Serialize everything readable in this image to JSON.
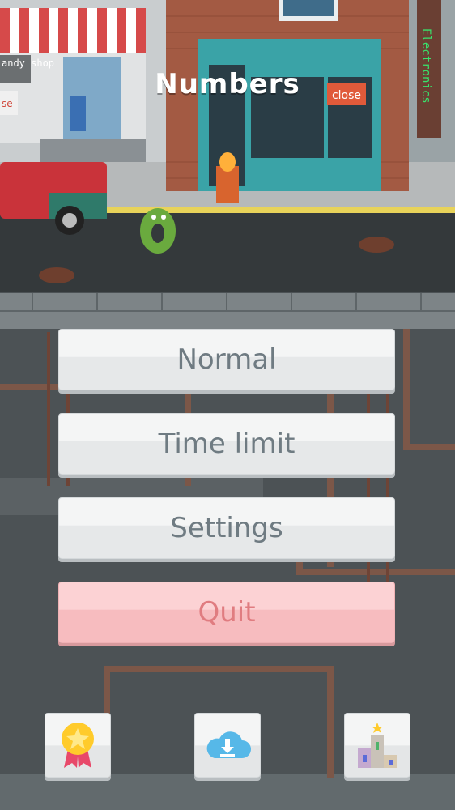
{
  "game": {
    "title": "Numbers"
  },
  "scene": {
    "candy_shop_sign": "andy shop",
    "close_sign_left": "se",
    "close_sign_right": "close",
    "neon_sign": "Electronics"
  },
  "menu": {
    "normal_label": "Normal",
    "time_limit_label": "Time limit",
    "settings_label": "Settings",
    "quit_label": "Quit"
  },
  "bottom_bar": {
    "achievements_icon": "medal-star-icon",
    "cloud_icon": "cloud-download-icon",
    "leaderboard_icon": "podium-icon"
  },
  "colors": {
    "button_text": "#6f7b82",
    "quit_text": "#e07c80",
    "quit_bg": "#fcd2d4",
    "neon_green": "#39e26b"
  }
}
